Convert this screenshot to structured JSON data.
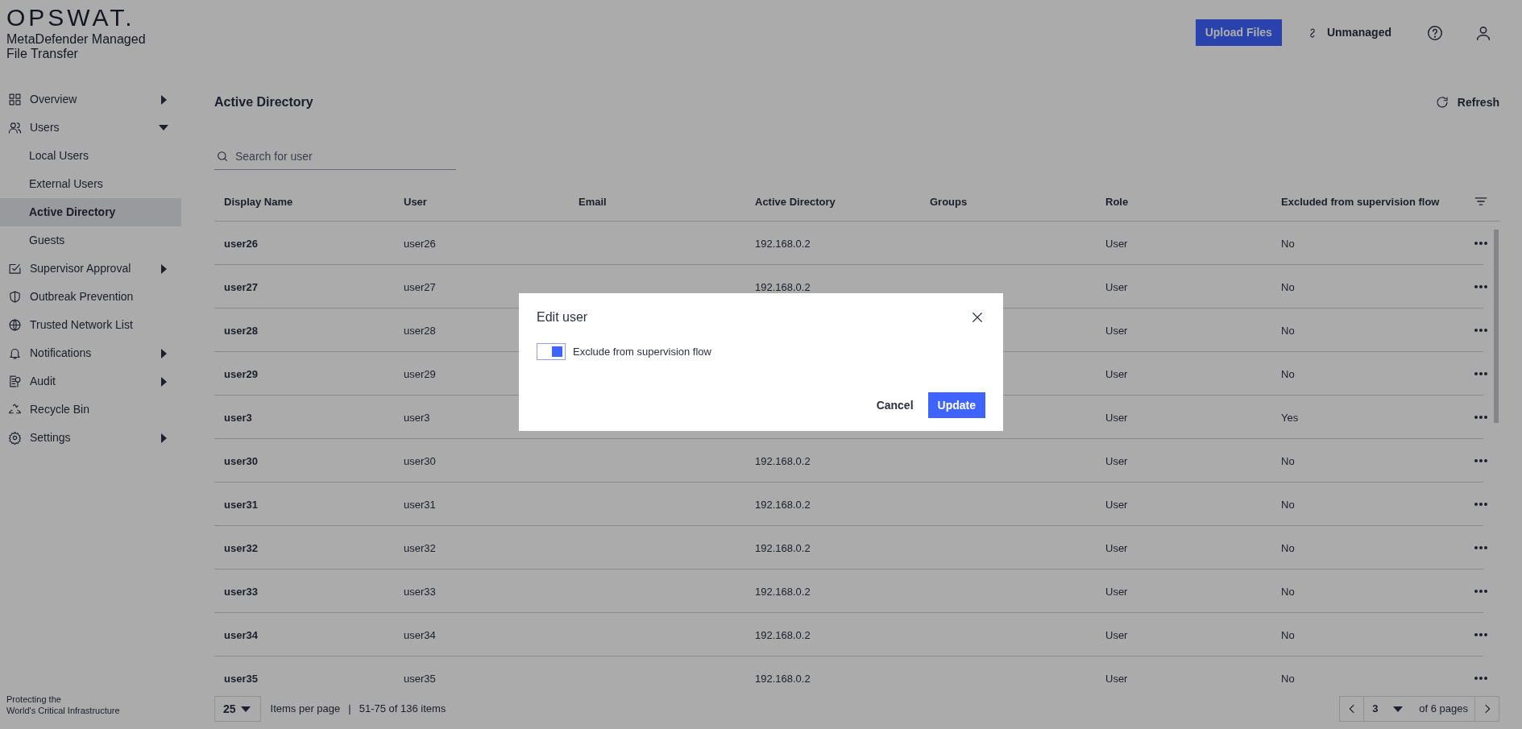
{
  "brand": {
    "logo": "OPSWAT.",
    "product": "MetaDefender Managed File Transfer"
  },
  "sidebar": {
    "items": [
      {
        "label": "Overview",
        "expanded": false
      },
      {
        "label": "Users",
        "expanded": true,
        "children": [
          {
            "label": "Local Users",
            "selected": false
          },
          {
            "label": "External Users",
            "selected": false
          },
          {
            "label": "Active Directory",
            "selected": true
          },
          {
            "label": "Guests",
            "selected": false
          }
        ]
      },
      {
        "label": "Supervisor Approval",
        "expanded": false
      },
      {
        "label": "Outbreak Prevention"
      },
      {
        "label": "Trusted Network List"
      },
      {
        "label": "Notifications",
        "expanded": false
      },
      {
        "label": "Audit",
        "expanded": false
      },
      {
        "label": "Recycle Bin"
      },
      {
        "label": "Settings",
        "expanded": false
      }
    ],
    "tagline_lines": [
      "Protecting the",
      "World's Critical Infrastructure"
    ]
  },
  "header": {
    "upload_button": "Upload Files",
    "mode": "Unmanaged"
  },
  "page": {
    "title": "Active Directory",
    "refresh": "Refresh",
    "search": {
      "placeholder": "Search for user"
    }
  },
  "table": {
    "columns": [
      "Display Name",
      "User",
      "Email",
      "Active Directory",
      "Groups",
      "Role",
      "Excluded from supervision flow"
    ],
    "rows": [
      {
        "display_name": "user26",
        "user": "user26",
        "active_directory": "192.168.0.2",
        "role": "User",
        "excluded": "No"
      },
      {
        "display_name": "user27",
        "user": "user27",
        "active_directory": "192.168.0.2",
        "role": "User",
        "excluded": "No"
      },
      {
        "display_name": "user28",
        "user": "user28",
        "role": "User",
        "excluded": "No"
      },
      {
        "display_name": "user29",
        "user": "user29",
        "role": "User",
        "excluded": "No"
      },
      {
        "display_name": "user3",
        "user": "user3",
        "role": "User",
        "excluded": "Yes"
      },
      {
        "display_name": "user30",
        "user": "user30",
        "active_directory": "192.168.0.2",
        "role": "User",
        "excluded": "No"
      },
      {
        "display_name": "user31",
        "user": "user31",
        "active_directory": "192.168.0.2",
        "role": "User",
        "excluded": "No"
      },
      {
        "display_name": "user32",
        "user": "user32",
        "active_directory": "192.168.0.2",
        "role": "User",
        "excluded": "No"
      },
      {
        "display_name": "user33",
        "user": "user33",
        "active_directory": "192.168.0.2",
        "role": "User",
        "excluded": "No"
      },
      {
        "display_name": "user34",
        "user": "user34",
        "active_directory": "192.168.0.2",
        "role": "User",
        "excluded": "No"
      },
      {
        "display_name": "user35",
        "user": "user35",
        "active_directory": "192.168.0.2",
        "role": "User",
        "excluded": "No"
      }
    ]
  },
  "pagination": {
    "page_size": "25",
    "items_per_page": "Items per page",
    "separator": "|",
    "range": "51-75 of 136 items",
    "page": "3",
    "of_pages": "of 6 pages"
  },
  "modal": {
    "title": "Edit user",
    "toggle": {
      "label": "Exclude from supervision flow",
      "on": true
    },
    "buttons": [
      {
        "label": "Cancel",
        "kind": "text"
      },
      {
        "label": "Update",
        "kind": "primary"
      }
    ]
  }
}
